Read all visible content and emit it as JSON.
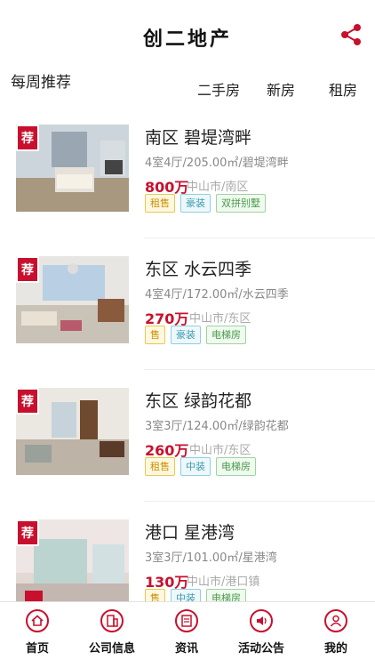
{
  "header": {
    "title": "创二地产"
  },
  "section": {
    "weekly_label": "每周推荐",
    "tabs": [
      "二手房",
      "新房",
      "租房"
    ]
  },
  "listings": [
    {
      "title": "南区  碧堤湾畔",
      "spec": "4室4厅/205.00㎡/碧堤湾畔",
      "price": "800万",
      "location": "中山市/南区",
      "badge": "荐",
      "tags": [
        {
          "label": "租售",
          "color": "yellow"
        },
        {
          "label": "豪装",
          "color": "blue"
        },
        {
          "label": "双拼别墅",
          "color": "green"
        }
      ]
    },
    {
      "title": "东区  水云四季",
      "spec": "4室4厅/172.00㎡/水云四季",
      "price": "270万",
      "location": "中山市/东区",
      "badge": "荐",
      "tags": [
        {
          "label": "售",
          "color": "yellow"
        },
        {
          "label": "豪装",
          "color": "blue"
        },
        {
          "label": "电梯房",
          "color": "green"
        }
      ]
    },
    {
      "title": "东区  绿韵花都",
      "spec": "3室3厅/124.00㎡/绿韵花都",
      "price": "260万",
      "location": "中山市/东区",
      "badge": "荐",
      "tags": [
        {
          "label": "租售",
          "color": "yellow"
        },
        {
          "label": "中装",
          "color": "blue"
        },
        {
          "label": "电梯房",
          "color": "green"
        }
      ]
    },
    {
      "title": "港口  星港湾",
      "spec": "3室3厅/101.00㎡/星港湾",
      "price": "130万",
      "location": "中山市/港口镇",
      "badge": "荐",
      "tags": [
        {
          "label": "售",
          "color": "yellow"
        },
        {
          "label": "中装",
          "color": "blue"
        },
        {
          "label": "电梯房",
          "color": "green"
        }
      ]
    }
  ],
  "bottom_nav": [
    {
      "label": "首页",
      "icon": "home-icon"
    },
    {
      "label": "公司信息",
      "icon": "building-icon"
    },
    {
      "label": "资讯",
      "icon": "news-icon"
    },
    {
      "label": "活动公告",
      "icon": "speaker-icon"
    },
    {
      "label": "我的",
      "icon": "user-icon"
    }
  ],
  "colors": {
    "accent": "#c8102e"
  }
}
